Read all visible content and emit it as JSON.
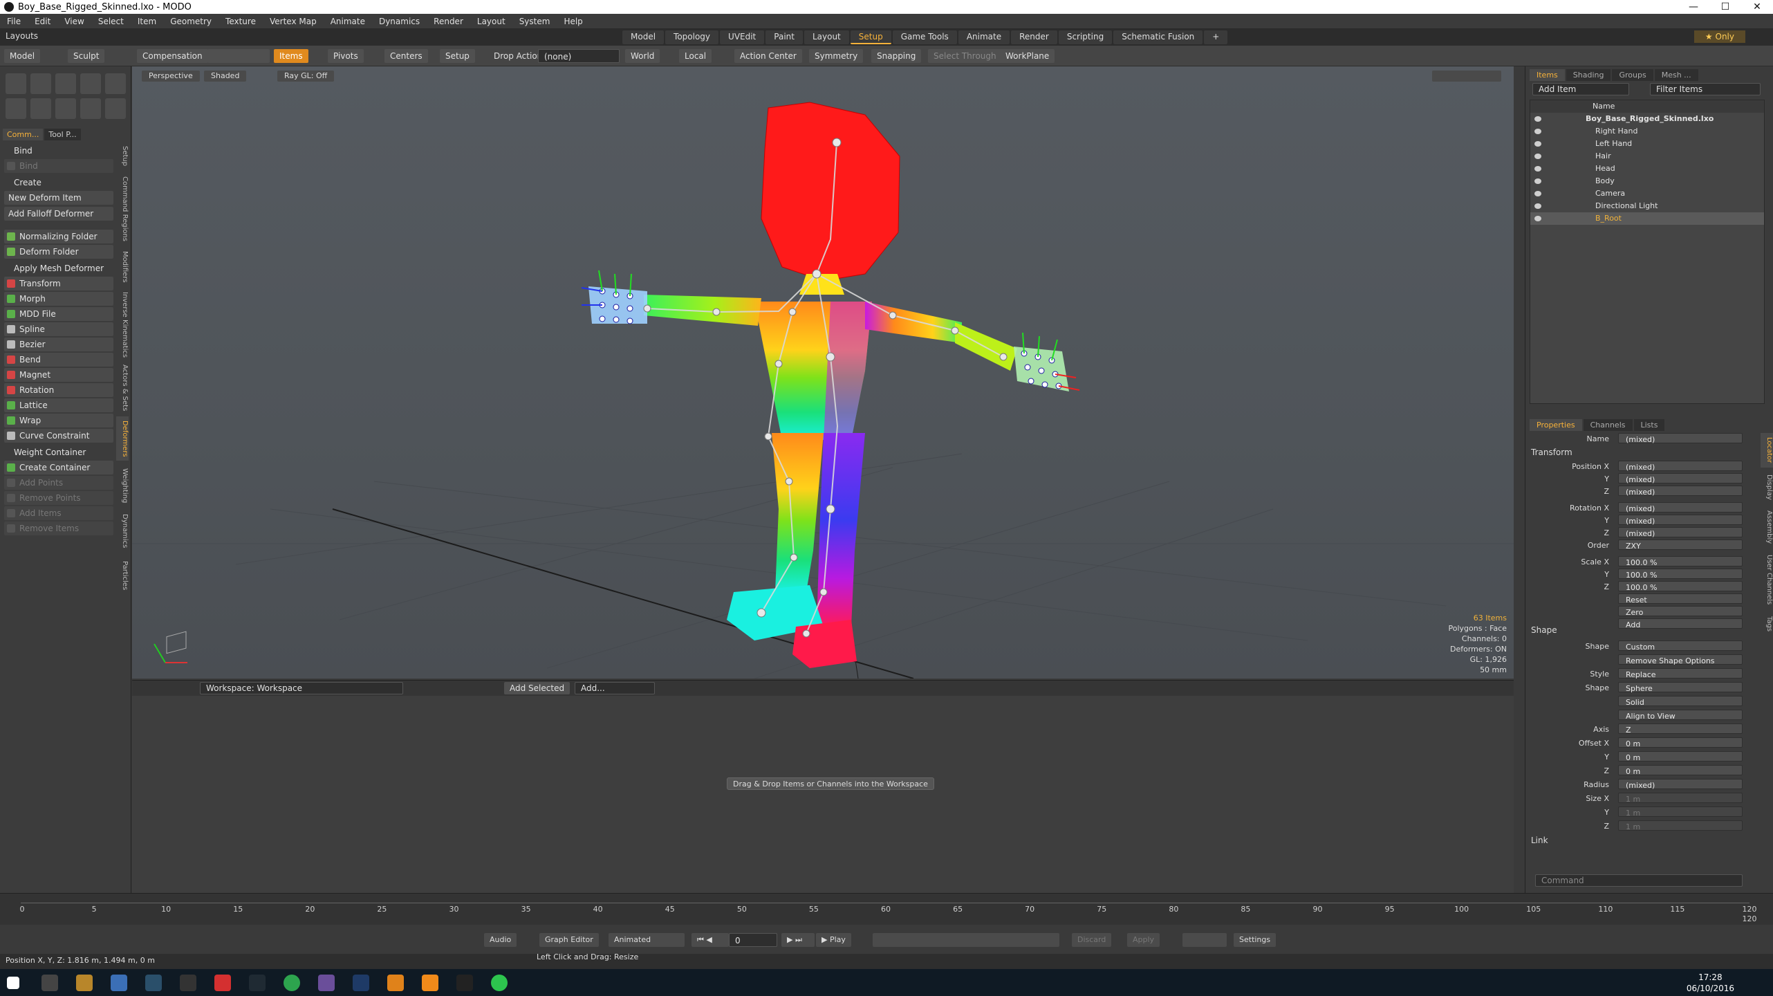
{
  "window": {
    "title": "Boy_Base_Rigged_Skinned.lxo - MODO"
  },
  "menu": [
    "File",
    "Edit",
    "View",
    "Select",
    "Item",
    "Geometry",
    "Texture",
    "Vertex Map",
    "Animate",
    "Dynamics",
    "Render",
    "Layout",
    "System",
    "Help"
  ],
  "layouts_label": "Layouts",
  "tabs": [
    "Model",
    "Topology",
    "UVEdit",
    "Paint",
    "Layout",
    "Setup",
    "Game Tools",
    "Animate",
    "Render",
    "Scripting",
    "Schematic Fusion"
  ],
  "active_tab": "Setup",
  "only_label": "Only",
  "toolbar": {
    "model": "Model",
    "sculpt": "Sculpt",
    "compensation": "Compensation",
    "items": "Items",
    "pivots": "Pivots",
    "centers": "Centers",
    "setup": "Setup",
    "drop_action": "Drop Action",
    "drop_value": "(none)",
    "world": "World",
    "local": "Local",
    "action_center": "Action Center",
    "symmetry": "Symmetry",
    "snapping": "Snapping",
    "select_through": "Select Through",
    "workplane": "WorkPlane"
  },
  "left_panel": {
    "tabs": [
      "Comm...",
      "Tool P..."
    ],
    "bind_header": "Bind",
    "bind": "Bind",
    "create_header": "Create",
    "new_deform_item": "New Deform Item",
    "add_falloff_deformer": "Add Falloff Deformer",
    "normalizing_folder": "Normalizing Folder",
    "deform_folder": "Deform Folder",
    "apply_mesh_deformer": "Apply Mesh Deformer",
    "deformers": [
      "Transform",
      "Morph",
      "MDD File",
      "Spline",
      "Bezier",
      "Bend",
      "Magnet",
      "Rotation",
      "Lattice",
      "Wrap",
      "Curve Constraint"
    ],
    "weight_container": "Weight Container",
    "create_container": "Create Container",
    "disabled_items": [
      "Add Points",
      "Remove Points",
      "Add Items",
      "Remove Items"
    ],
    "vertical_tabs": [
      "Setup",
      "Command Regions",
      "Modifiers",
      "Inverse Kinematics",
      "Actors & Sets",
      "Deformers",
      "Weighting",
      "Dynamics",
      "Particles"
    ]
  },
  "viewport": {
    "view": "Perspective",
    "shading": "Shaded",
    "raygl": "Ray GL: Off",
    "stats": [
      "63 Items",
      "Polygons : Face",
      "Channels: 0",
      "Deformers: ON",
      "GL: 1,926",
      "50 mm"
    ]
  },
  "workspace": {
    "name": "Workspace: Workspace",
    "add_selected": "Add Selected",
    "add": "Add...",
    "message": "Drag & Drop Items or Channels into the Workspace"
  },
  "right_panel": {
    "tabs": [
      "Items",
      "Shading",
      "Groups",
      "Mesh ..."
    ],
    "add_item": "Add Item",
    "filter_items": "Filter Items",
    "name_col": "Name",
    "tree": [
      {
        "label": "Boy_Base_Rigged_Skinned.lxo",
        "indent": 0,
        "bold": true
      },
      {
        "label": "Right Hand",
        "indent": 1
      },
      {
        "label": "Left Hand",
        "indent": 1
      },
      {
        "label": "Hair",
        "indent": 1
      },
      {
        "label": "Head",
        "indent": 1
      },
      {
        "label": "Body",
        "indent": 1
      },
      {
        "label": "Camera",
        "indent": 1
      },
      {
        "label": "Directional Light",
        "indent": 1
      },
      {
        "label": "B_Root",
        "indent": 1,
        "selected": true
      }
    ],
    "prop_tabs": [
      "Properties",
      "Channels",
      "Lists"
    ],
    "name_label": "Name",
    "name_value": "(mixed)",
    "transform_header": "Transform",
    "props": [
      {
        "label": "Position X",
        "value": "(mixed)"
      },
      {
        "label": "Y",
        "value": "(mixed)"
      },
      {
        "label": "Z",
        "value": "(mixed)"
      },
      {
        "label": "Rotation X",
        "value": "(mixed)"
      },
      {
        "label": "Y",
        "value": "(mixed)"
      },
      {
        "label": "Z",
        "value": "(mixed)"
      },
      {
        "label": "Order",
        "value": "ZXY"
      },
      {
        "label": "Scale X",
        "value": "100.0 %"
      },
      {
        "label": "Y",
        "value": "100.0 %"
      },
      {
        "label": "Z",
        "value": "100.0 %"
      }
    ],
    "reset": "Reset",
    "zero": "Zero",
    "add": "Add",
    "shape_header": "Shape",
    "shape_props": [
      {
        "label": "Shape",
        "value": "Custom"
      },
      {
        "label": "",
        "value": "Remove Shape Options"
      },
      {
        "label": "Style",
        "value": "Replace"
      },
      {
        "label": "Shape",
        "value": "Sphere"
      },
      {
        "label": "",
        "value": "Solid"
      },
      {
        "label": "",
        "value": "Align to View"
      },
      {
        "label": "Axis",
        "value": "Z"
      },
      {
        "label": "Offset X",
        "value": "0 m"
      },
      {
        "label": "Y",
        "value": "0 m"
      },
      {
        "label": "Z",
        "value": "0 m"
      },
      {
        "label": "Radius",
        "value": "(mixed)"
      },
      {
        "label": "Size X",
        "value": "1 m"
      },
      {
        "label": "Y",
        "value": "1 m"
      },
      {
        "label": "Z",
        "value": "1 m"
      }
    ],
    "link_header": "Link",
    "command_placeholder": "Command",
    "vertical_tabs": [
      "Locator",
      "Display",
      "Assembly",
      "User Channels",
      "Tags"
    ]
  },
  "timeline": {
    "ticks": [
      0,
      5,
      10,
      15,
      20,
      25,
      30,
      35,
      40,
      45,
      50,
      55,
      60,
      65,
      70,
      75,
      80,
      85,
      90,
      95,
      100,
      105,
      110,
      115,
      120
    ],
    "end_frame": "120"
  },
  "controls": {
    "audio": "Audio",
    "graph_editor": "Graph Editor",
    "animated": "Animated",
    "frame": "0",
    "play": "Play",
    "discard": "Discard",
    "apply": "Apply",
    "settings": "Settings"
  },
  "status": {
    "position": "Position X, Y, Z:  1.816 m, 1.494 m, 0 m",
    "hint": "Left Click and Drag:  Resize"
  },
  "taskbar": {
    "time": "17:28",
    "date": "06/10/2016"
  }
}
